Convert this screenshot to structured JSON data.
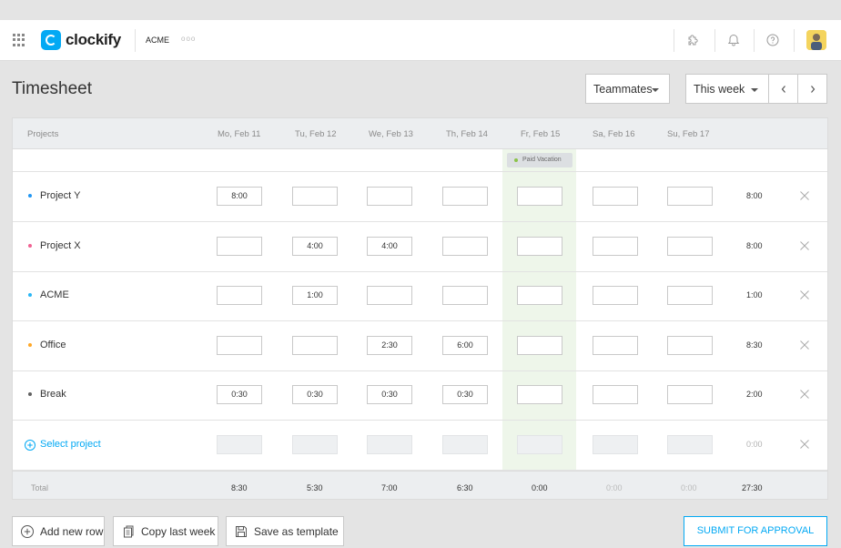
{
  "topbar": {
    "brand": "clockify",
    "workspace": "ACME",
    "workspace_dots": "ooo",
    "icons": [
      "apps-grid-icon",
      "puzzle-icon",
      "bell-icon",
      "help-icon",
      "user-avatar"
    ]
  },
  "header": {
    "title": "Timesheet",
    "teammates_label": "Teammates",
    "period_label": "This week"
  },
  "table": {
    "projects_header": "Projects",
    "days": [
      "Mo, Feb 11",
      "Tu, Feb 12",
      "We, Feb 13",
      "Th, Feb 14",
      "Fr, Feb 15",
      "Sa, Feb 16",
      "Su, Feb 17"
    ],
    "holiday_tag": "Paid Vacation",
    "rows": [
      {
        "name": "Project Y",
        "color": "#2196f3",
        "values": [
          "8:00",
          "",
          "",
          "",
          "",
          "",
          ""
        ],
        "total": "8:00"
      },
      {
        "name": "Project X",
        "color": "#f06292",
        "values": [
          "",
          "4:00",
          "4:00",
          "",
          "",
          "",
          ""
        ],
        "total": "8:00"
      },
      {
        "name": "ACME",
        "color": "#29b6f6",
        "values": [
          "",
          "1:00",
          "",
          "",
          "",
          "",
          ""
        ],
        "total": "1:00"
      },
      {
        "name": "Office",
        "color": "#ffa726",
        "values": [
          "",
          "",
          "2:30",
          "6:00",
          "",
          "",
          ""
        ],
        "total": "8:30"
      },
      {
        "name": "Break",
        "color": "#616161",
        "values": [
          "0:30",
          "0:30",
          "0:30",
          "0:30",
          "",
          "",
          ""
        ],
        "total": "2:00"
      }
    ],
    "select_project_label": "Select project",
    "select_total": "0:00",
    "total_label": "Total",
    "day_totals": [
      "8:30",
      "5:30",
      "7:00",
      "6:30",
      "0:00",
      "0:00",
      "0:00"
    ],
    "grand_total": "27:30"
  },
  "footer": {
    "add_row": "Add new row",
    "copy_week": "Copy last week",
    "save_template": "Save as template",
    "submit": "SUBMIT FOR APPROVAL"
  },
  "colors": {
    "accent": "#03a9f4",
    "friday_highlight": "#eef6ea"
  }
}
